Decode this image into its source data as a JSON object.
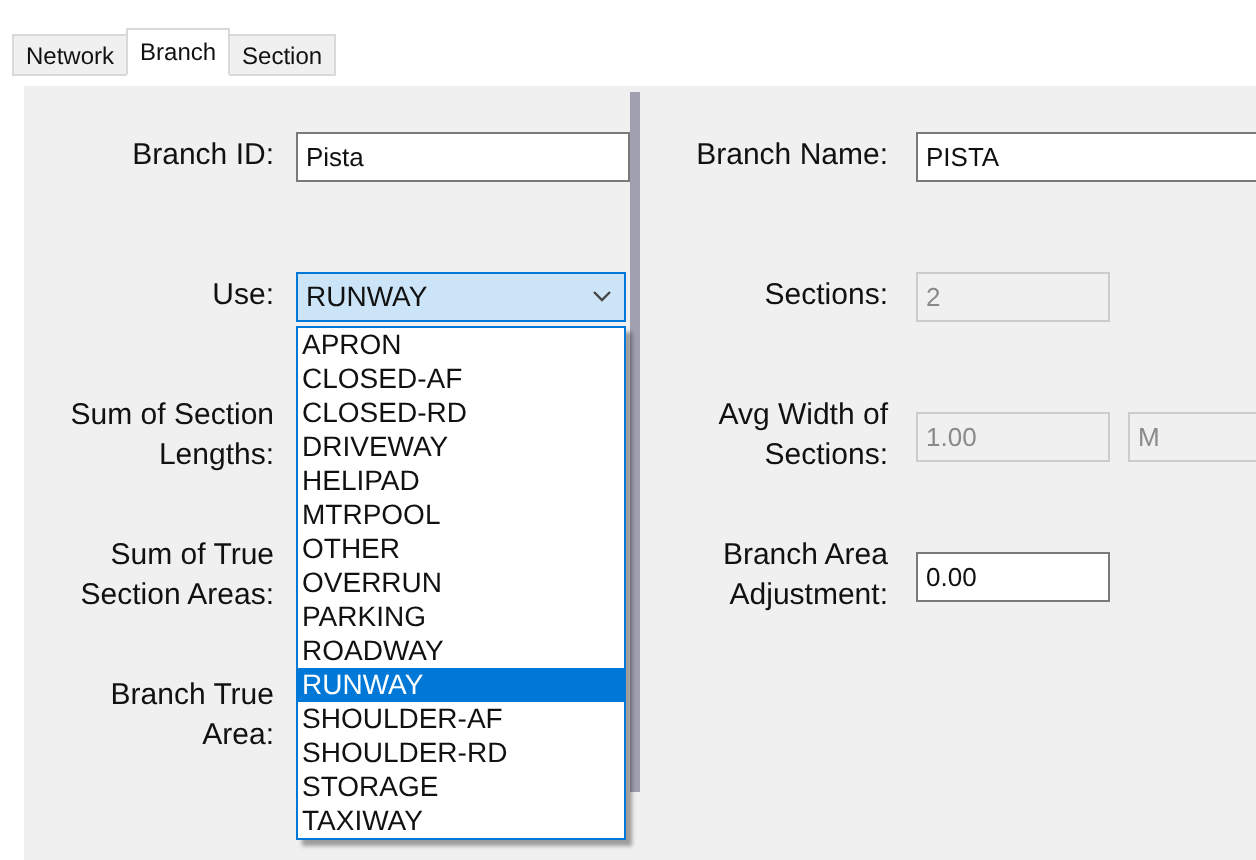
{
  "tabs": [
    {
      "label": "Network",
      "selected": false
    },
    {
      "label": "Branch",
      "selected": true
    },
    {
      "label": "Section",
      "selected": false
    }
  ],
  "left_fields": [
    {
      "kind": "text",
      "label": "Branch ID:",
      "value": "Pista",
      "disabled": false
    },
    {
      "kind": "combo",
      "label": "Use:",
      "value": "RUNWAY",
      "expanded": true
    },
    {
      "kind": "label",
      "label": "Sum of Section\nLengths:"
    },
    {
      "kind": "label",
      "label": "Sum of True\nSection Areas:"
    },
    {
      "kind": "label",
      "label": "Branch True\nArea:"
    }
  ],
  "use_options": [
    {
      "label": "APRON",
      "selected": false
    },
    {
      "label": "CLOSED-AF",
      "selected": false
    },
    {
      "label": "CLOSED-RD",
      "selected": false
    },
    {
      "label": "DRIVEWAY",
      "selected": false
    },
    {
      "label": "HELIPAD",
      "selected": false
    },
    {
      "label": "MTRPOOL",
      "selected": false
    },
    {
      "label": "OTHER",
      "selected": false
    },
    {
      "label": "OVERRUN",
      "selected": false
    },
    {
      "label": "PARKING",
      "selected": false
    },
    {
      "label": "ROADWAY",
      "selected": false
    },
    {
      "label": "RUNWAY",
      "selected": true
    },
    {
      "label": "SHOULDER-AF",
      "selected": false
    },
    {
      "label": "SHOULDER-RD",
      "selected": false
    },
    {
      "label": "STORAGE",
      "selected": false
    },
    {
      "label": "TAXIWAY",
      "selected": false
    }
  ],
  "right_fields": [
    {
      "kind": "text",
      "label": "Branch Name:",
      "value": "PISTA",
      "disabled": false
    },
    {
      "kind": "text",
      "label": "Sections:",
      "value": "2",
      "disabled": true
    },
    {
      "kind": "pair",
      "label": "Avg Width of\nSections:",
      "value": "1.00",
      "unit": "M",
      "disabled": true
    },
    {
      "kind": "text",
      "label": "Branch Area\nAdjustment:",
      "value": "0.00",
      "disabled": false
    }
  ]
}
